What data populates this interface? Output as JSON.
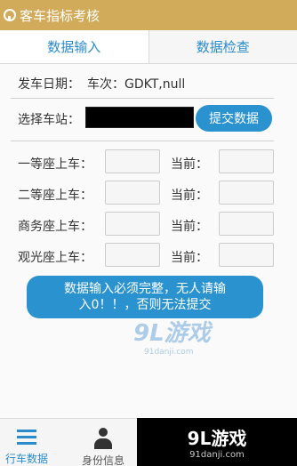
{
  "app": {
    "title": "客车指标考核"
  },
  "tabs": [
    {
      "label": "数据输入"
    },
    {
      "label": "数据检查"
    }
  ],
  "trip": {
    "date_label": "发车日期：",
    "train_label": "车次：",
    "train_value": "GDKT,null"
  },
  "station": {
    "label": "选择车站：",
    "submit_label": "提交数据"
  },
  "seats": [
    {
      "label": "一等座上车：",
      "current_label": "当前："
    },
    {
      "label": "二等座上车：",
      "current_label": "当前："
    },
    {
      "label": "商务座上车：",
      "current_label": "当前："
    },
    {
      "label": "观光座上车：",
      "current_label": "当前："
    }
  ],
  "notice": {
    "line1": "数据输入必须完整，无人请输",
    "line2": "入0！！，否则无法提交"
  },
  "watermark": {
    "logo_text": "9L游戏",
    "url": "91danji.com"
  },
  "bottom_nav": {
    "items": [
      {
        "label": "行车数据",
        "icon": "list-icon"
      },
      {
        "label": "身份信息",
        "icon": "user-icon"
      }
    ]
  },
  "brand": {
    "name": "9L游戏",
    "url": "91danji.com"
  },
  "colors": {
    "title_bar": "#d2ab5a",
    "accent": "#2a93cf"
  }
}
